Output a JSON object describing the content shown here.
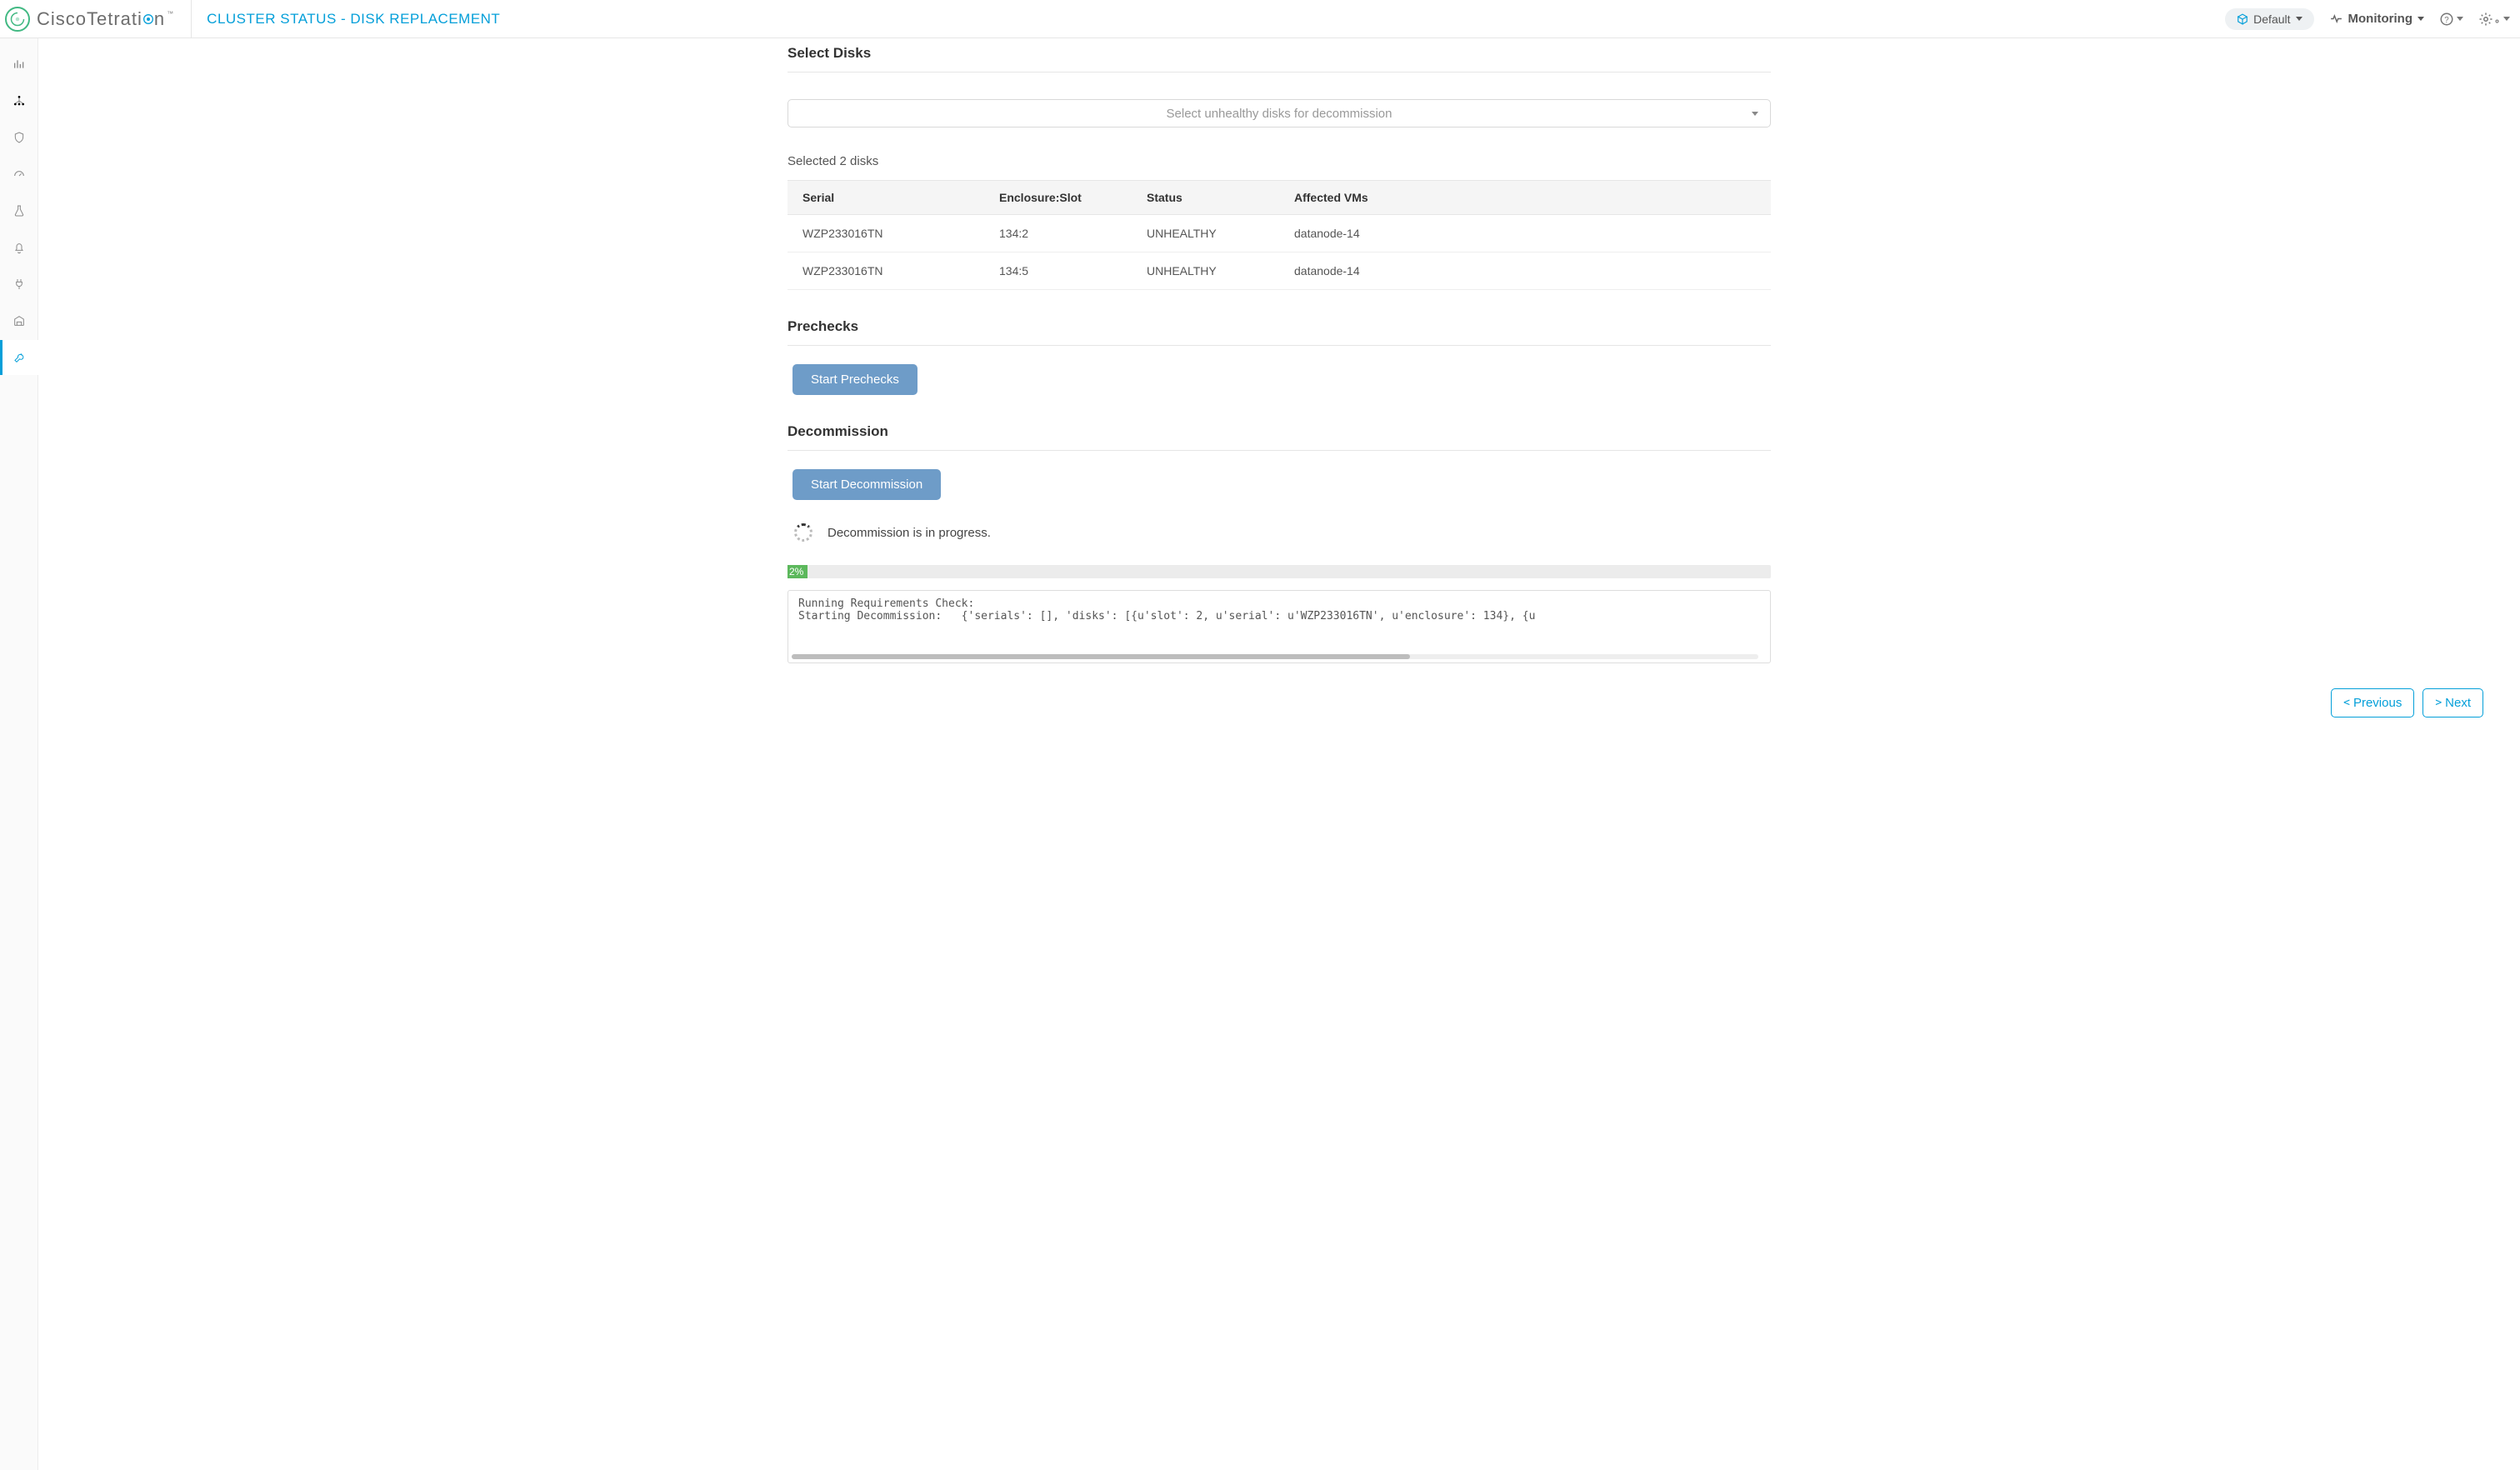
{
  "header": {
    "brand_prefix": "CiscoTetrati",
    "brand_suffix": "n",
    "page_title": "CLUSTER STATUS - DISK REPLACEMENT",
    "scope_label": "Default",
    "monitoring_label": "Monitoring"
  },
  "sections": {
    "select_disks_title": "Select Disks",
    "select_placeholder": "Select unhealthy disks for decommission",
    "selected_count_label": "Selected 2 disks",
    "prechecks_title": "Prechecks",
    "prechecks_button": "Start Prechecks",
    "decommission_title": "Decommission",
    "decommission_button": "Start Decommission",
    "progress_text": "Decommission is in progress.",
    "progress_percent": "2%",
    "log_line_1": "Running Requirements Check:",
    "log_line_2": "Starting Decommission:   {'serials': [], 'disks': [{u'slot': 2, u'serial': u'WZP233016TN', u'enclosure': 134}, {u"
  },
  "table": {
    "headers": {
      "serial": "Serial",
      "slot": "Enclosure:Slot",
      "status": "Status",
      "vms": "Affected VMs"
    },
    "rows": [
      {
        "serial": "WZP233016TN",
        "slot": "134:2",
        "status": "UNHEALTHY",
        "vms": "datanode-14"
      },
      {
        "serial": "WZP233016TN",
        "slot": "134:5",
        "status": "UNHEALTHY",
        "vms": "datanode-14"
      }
    ]
  },
  "footer": {
    "prev_label": "Previous",
    "next_label": "Next"
  }
}
